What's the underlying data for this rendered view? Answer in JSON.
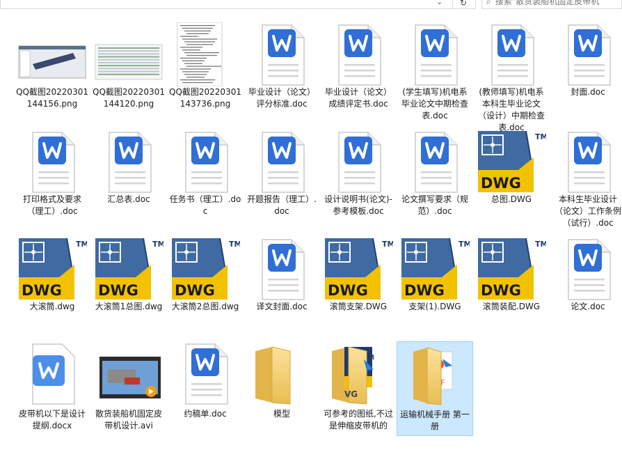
{
  "toolbar": {
    "dropdown_icon": "chevron-down-icon",
    "refresh_icon": "refresh-icon",
    "search_text": "搜索\"散货装船机固定皮带机"
  },
  "files": [
    {
      "name": "QQ截图20220301144156.png",
      "type": "png-cad"
    },
    {
      "name": "QQ截图20220301144120.png",
      "type": "png-table"
    },
    {
      "name": "QQ截图20220301143736.png",
      "type": "png-doc"
    },
    {
      "name": "毕业设计（论文）评分标准.doc",
      "type": "doc"
    },
    {
      "name": "毕业设计（论文）成绩评定书.doc",
      "type": "doc"
    },
    {
      "name": "(学生填写)机电系毕业论文中期检查表.doc",
      "type": "doc"
    },
    {
      "name": "(教师填写)机电系本科生毕业论文（设计）中期检查表.doc",
      "type": "doc"
    },
    {
      "name": "封面.doc",
      "type": "doc"
    },
    {
      "name": "打印格式及要求（理工）.doc",
      "type": "doc"
    },
    {
      "name": "汇总表.doc",
      "type": "doc"
    },
    {
      "name": "任务书（理工）.doc",
      "type": "doc"
    },
    {
      "name": "开题报告（理工）.doc",
      "type": "doc"
    },
    {
      "name": "设计说明书(论文)-参考模板.doc",
      "type": "doc"
    },
    {
      "name": "论文撰写要求（规范）.doc",
      "type": "doc"
    },
    {
      "name": "总图.DWG",
      "type": "dwg"
    },
    {
      "name": "本科生毕业设计（论文）工作条例（试行）.doc",
      "type": "doc"
    },
    {
      "name": "大滚筒.dwg",
      "type": "dwg"
    },
    {
      "name": "大滚筒1总图.dwg",
      "type": "dwg"
    },
    {
      "name": "大滚筒2总图.dwg",
      "type": "dwg"
    },
    {
      "name": "译文封面.doc",
      "type": "doc"
    },
    {
      "name": "滚筒支架.DWG",
      "type": "dwg"
    },
    {
      "name": "支架(1).DWG",
      "type": "dwg"
    },
    {
      "name": "滚筒装配.DWG",
      "type": "dwg"
    },
    {
      "name": "论文.doc",
      "type": "doc"
    },
    {
      "name": "皮带机以下是设计提纲.docx",
      "type": "docx"
    },
    {
      "name": "散货装船机固定皮带机设计.avi",
      "type": "avi"
    },
    {
      "name": "约稿单.doc",
      "type": "doc"
    },
    {
      "name": "模型",
      "type": "folder"
    },
    {
      "name": "可参考的图纸,不过是伸缩皮带机的",
      "type": "folder-dwg"
    },
    {
      "name": "运输机械手册 第一册",
      "type": "folder-pdf",
      "selected": true
    }
  ],
  "dwg_badge": "DWG",
  "dwg_tm": "TM",
  "pdf_badge": "PDF",
  "colors": {
    "word_blue": "#2f6fd6",
    "dwg_yellow": "#f2c200",
    "dwg_navy": "#1d3b6e",
    "folder": "#f3d17a",
    "selection": "#cce8ff"
  }
}
